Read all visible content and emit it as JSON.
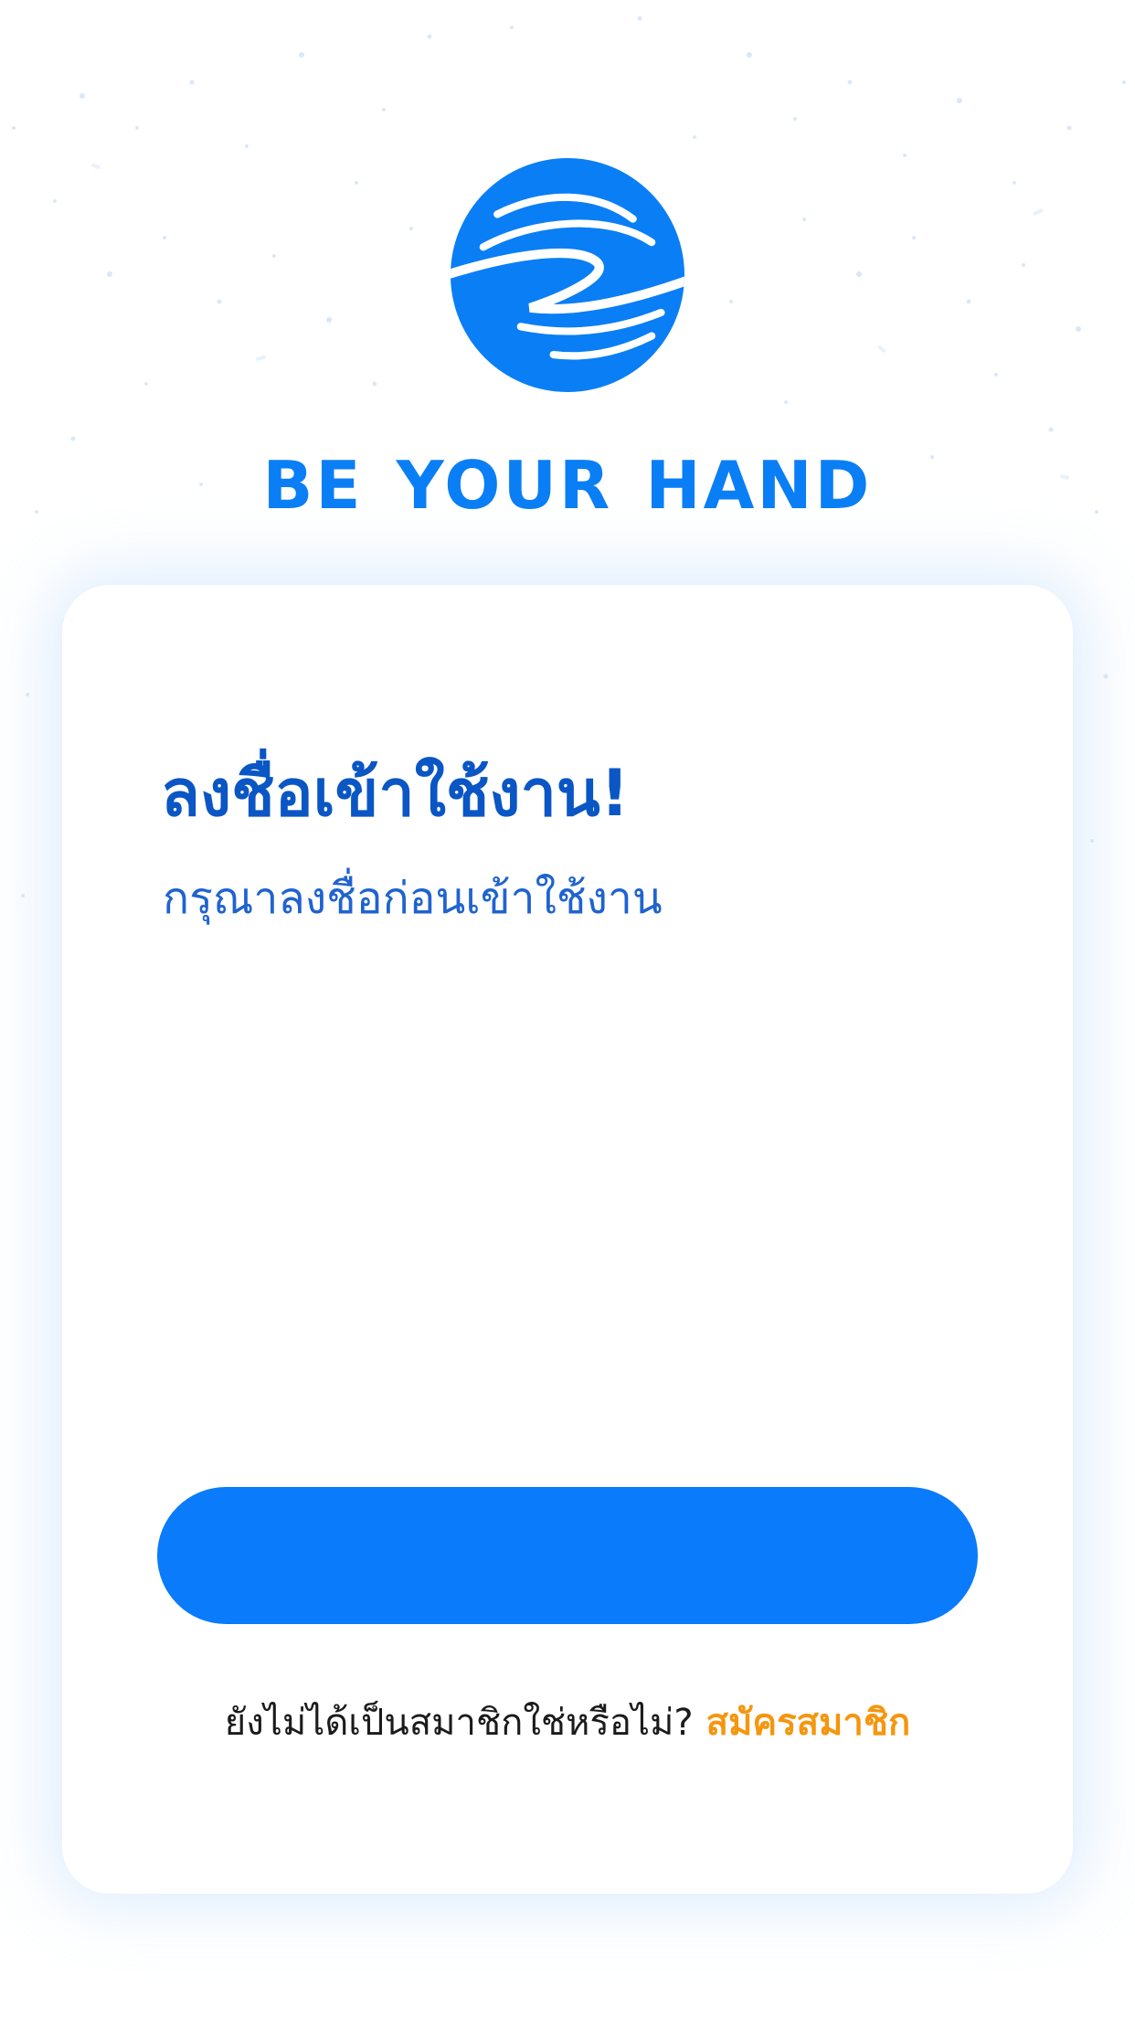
{
  "brand": {
    "name": "BE YOUR HAND",
    "logo_icon": "globe-hand-icon",
    "color": "#0a7ef5"
  },
  "login_card": {
    "title": "ลงชื่อเข้าใช้งาน!",
    "subtitle": "กรุณาลงชื่อก่อนเข้าใช้งาน",
    "primary_button_label": "",
    "signup_prompt": "ยังไม่ได้เป็นสมาชิกใช่หรือไม่?",
    "signup_link": "สมัครสมาชิก"
  },
  "colors": {
    "title": "#0a56c4",
    "subtitle": "#1f63cf",
    "button": "#0a7bfa",
    "link": "#f5960f",
    "card_shadow": "#b4d4fa"
  }
}
